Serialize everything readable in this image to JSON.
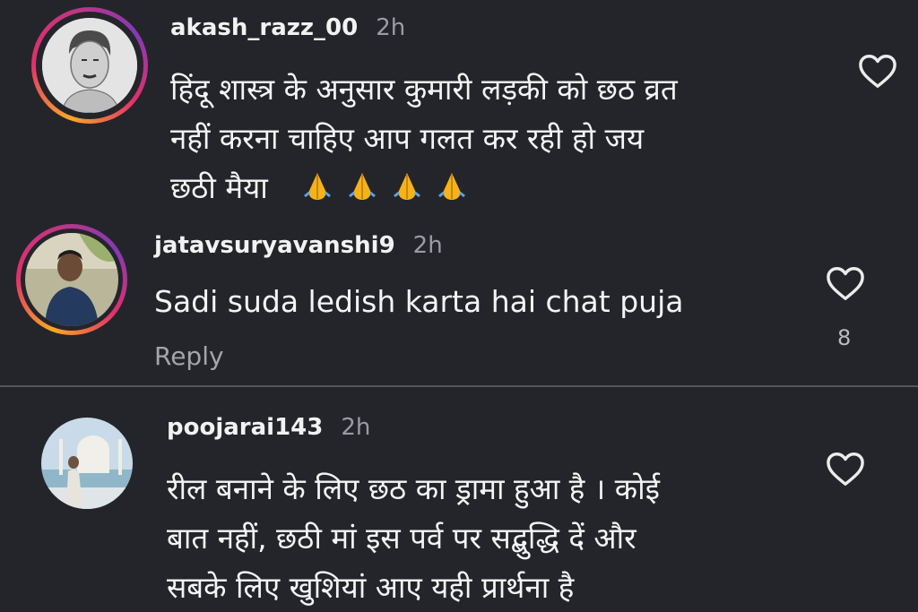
{
  "comments": [
    {
      "username": "akash_razz_00",
      "time": "2h",
      "text": "हिंदू शास्त्र के अनुसार कुमारी लड़की को छठ व्रत नहीं करना चाहिए आप गलत कर रही हो जय छठी मैया",
      "text_line1": "हिंदू शास्त्र के अनुसार कुमारी लड़की को छठ व्रत",
      "text_line2": "नहीं करना चाहिए आप गलत कर रही हो जय",
      "text_line3": "छठी मैया",
      "emoji": "folded-hands",
      "emoji_count": 4
    },
    {
      "username": "jatavsuryavanshi9",
      "time": "2h",
      "text": "Sadi suda ledish karta hai chat puja",
      "likes": "8",
      "reply_label": "Reply"
    },
    {
      "username": "poojarai143",
      "time": "2h",
      "text_line1": "रील बनाने के लिए छठ का ड्रामा हुआ है । कोई",
      "text_line2": "बात नहीं, छठी मां इस पर्व पर सद्बुद्धि दें और",
      "text_line3": "सबके लिए खुशियां आए यही प्रार्थना है"
    }
  ],
  "icons": {
    "like": "heart-outline-icon",
    "emoji": "folded-hands-emoji"
  },
  "colors": {
    "background": "#24252a",
    "username": "#f2f2f2",
    "timestamp": "#9a9ca3",
    "story_ring": [
      "#f9a825",
      "#e1306c",
      "#833ab4"
    ]
  }
}
